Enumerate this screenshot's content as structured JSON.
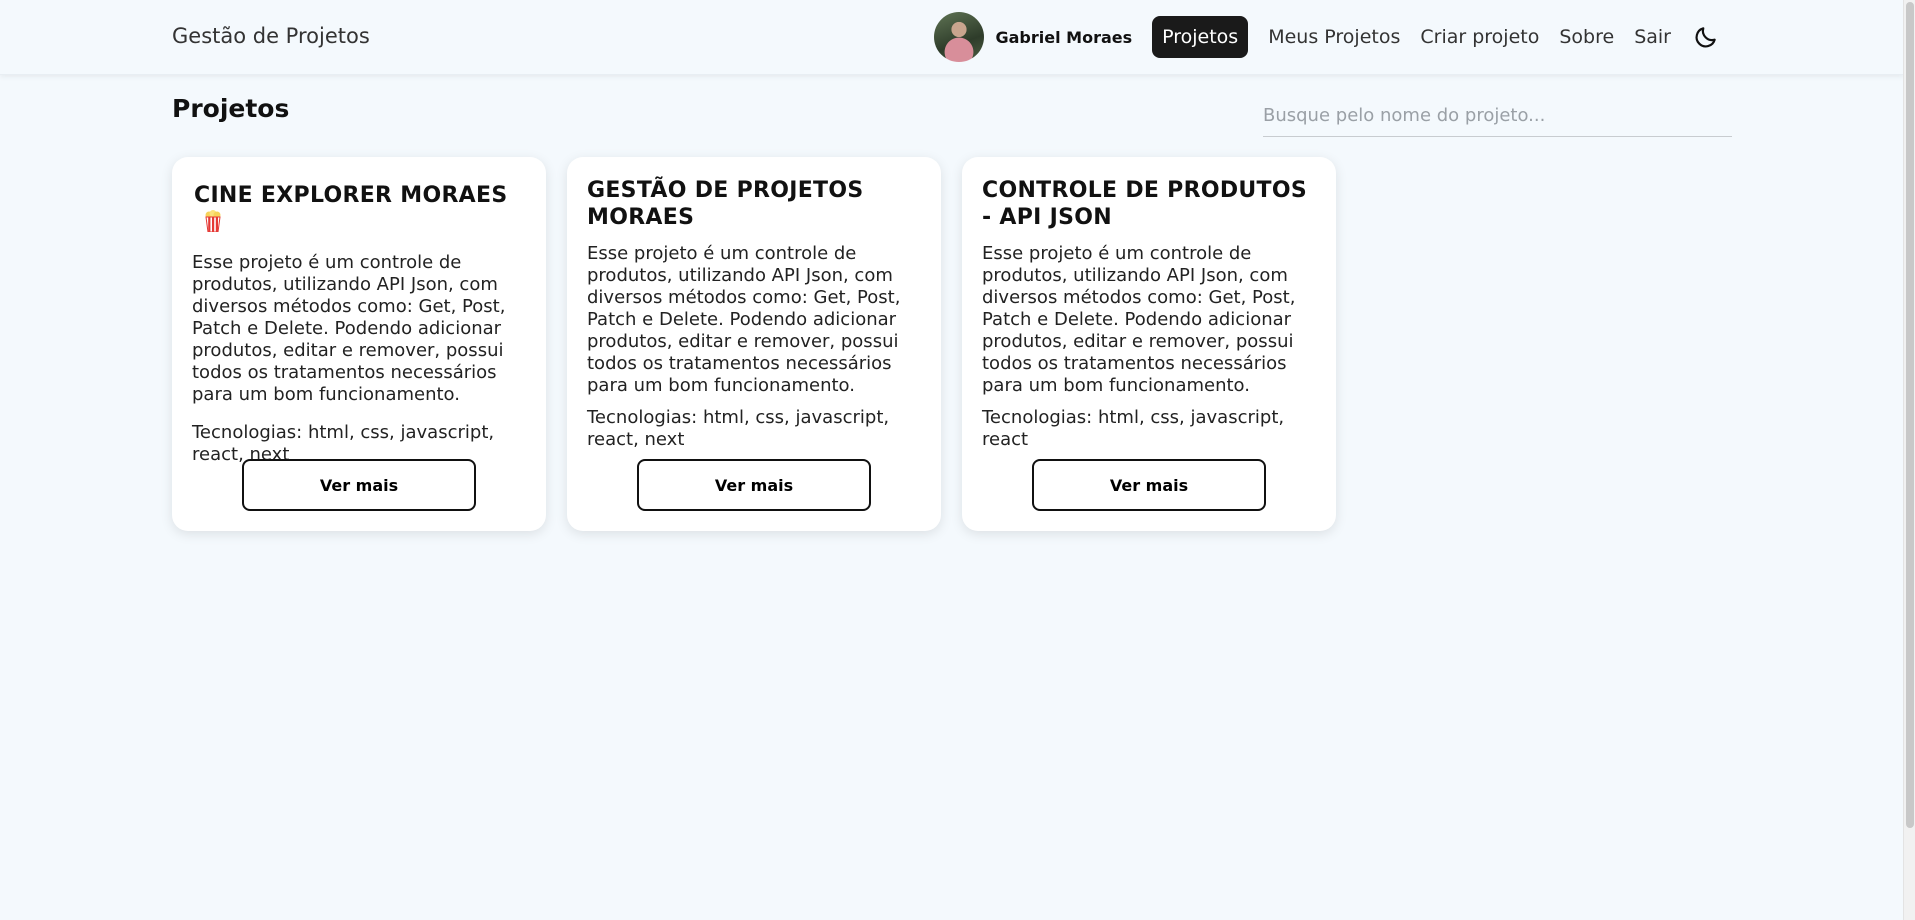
{
  "header": {
    "brand": "Gestão de Projetos",
    "user_name": "Gabriel Moraes",
    "nav": [
      {
        "label": "Projetos",
        "active": true
      },
      {
        "label": "Meus Projetos"
      },
      {
        "label": "Criar projeto"
      },
      {
        "label": "Sobre"
      },
      {
        "label": "Sair"
      }
    ],
    "theme_icon": "moon-icon"
  },
  "main": {
    "title": "Projetos",
    "search_placeholder": "Busque pelo nome do projeto...",
    "cards": [
      {
        "title": "CINE EXPLORER MORAES",
        "icon": "popcorn-icon",
        "description": "Esse projeto é um controle de produtos, utilizando API Json, com diversos métodos como: Get, Post, Patch e Delete. Podendo adicionar produtos, editar e remover, possui todos os tratamentos necessários para um bom funcionamento.",
        "technologies": "Tecnologias: html, css, javascript, react, next",
        "button": "Ver mais"
      },
      {
        "title": "GESTÃO DE PROJETOS MORAES",
        "description": "Esse projeto é um controle de produtos, utilizando API Json, com diversos métodos como: Get, Post, Patch e Delete. Podendo adicionar produtos, editar e remover, possui todos os tratamentos necessários para um bom funcionamento.",
        "technologies": "Tecnologias: html, css, javascript, react, next",
        "button": "Ver mais"
      },
      {
        "title": "CONTROLE DE PRODUTOS - API JSON",
        "description": "Esse projeto é um controle de produtos, utilizando API Json, com diversos métodos como: Get, Post, Patch e Delete. Podendo adicionar produtos, editar e remover, possui todos os tratamentos necessários para um bom funcionamento.",
        "technologies": "Tecnologias: html, css, javascript, react",
        "button": "Ver mais"
      }
    ]
  },
  "colors": {
    "background": "#f4f9fd",
    "active_nav": "#1a1a1a",
    "card": "#ffffff"
  }
}
